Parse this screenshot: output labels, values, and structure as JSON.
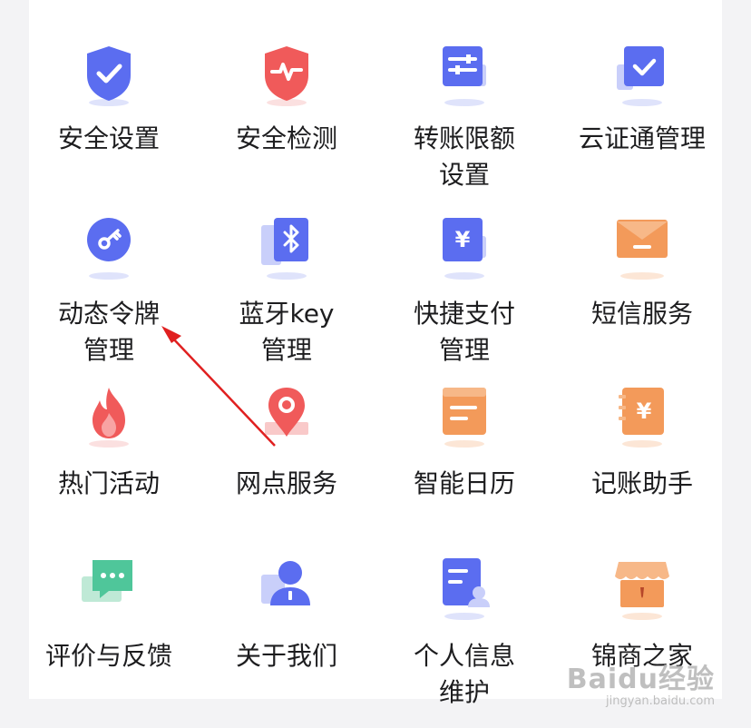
{
  "menu": {
    "items": [
      {
        "label": "安全设置",
        "icon": "shield-check-icon"
      },
      {
        "label": "安全检测",
        "icon": "shield-pulse-icon"
      },
      {
        "label": "转账限额\n设置",
        "icon": "sliders-icon"
      },
      {
        "label": "云证通管理",
        "icon": "checkbox-card-icon"
      },
      {
        "label": "动态令牌\n管理",
        "icon": "key-token-icon"
      },
      {
        "label": "蓝牙key\n管理",
        "icon": "bluetooth-icon"
      },
      {
        "label": "快捷支付\n管理",
        "icon": "yen-card-icon"
      },
      {
        "label": "短信服务",
        "icon": "envelope-icon"
      },
      {
        "label": "热门活动",
        "icon": "flame-icon"
      },
      {
        "label": "网点服务",
        "icon": "map-pin-icon"
      },
      {
        "label": "智能日历",
        "icon": "calendar-icon"
      },
      {
        "label": "记账助手",
        "icon": "yen-notebook-icon"
      },
      {
        "label": "评价与反馈",
        "icon": "chat-bubble-icon"
      },
      {
        "label": "关于我们",
        "icon": "user-info-icon"
      },
      {
        "label": "个人信息\n维护",
        "icon": "profile-document-icon"
      },
      {
        "label": "锦商之家",
        "icon": "storefront-icon"
      }
    ]
  },
  "watermark": {
    "main": "Baidu经验",
    "sub": "jingyan.baidu.com"
  },
  "colors": {
    "blue": "#5b6df0",
    "red": "#f05a5a",
    "orange": "#f39a5a",
    "green": "#4fc69a"
  }
}
